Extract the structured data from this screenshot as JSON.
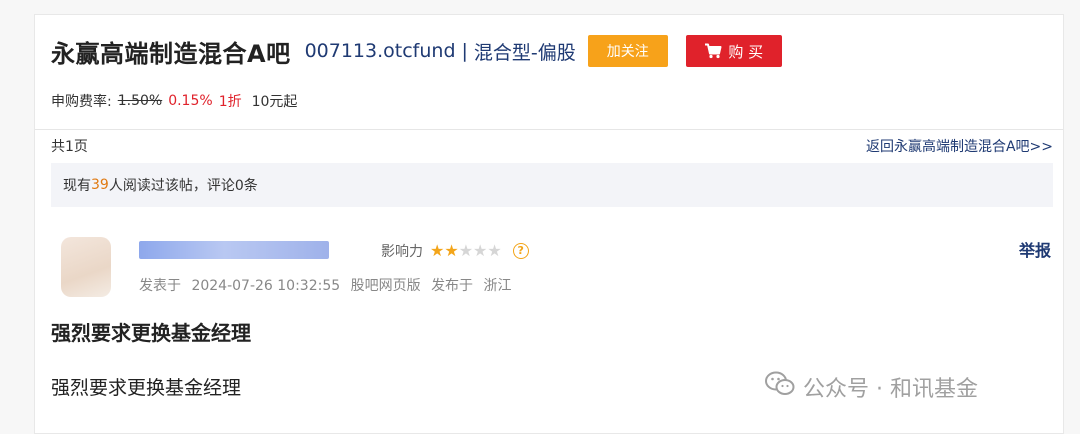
{
  "header": {
    "fund_name": "永赢高端制造混合A吧",
    "fund_code": "007113.otcfund",
    "separator": "|",
    "fund_type": "混合型-偏股",
    "follow_label": "加关注",
    "buy_label": "购 买"
  },
  "fees": {
    "label": "申购费率:",
    "original": "1.50%",
    "discounted": "0.15%",
    "discount": "1折",
    "minimum": "10元起"
  },
  "pagination": {
    "page_count": "共1页",
    "back_link": "返回永赢高端制造混合A吧>>"
  },
  "reads": {
    "prefix": "现有",
    "count": "39",
    "suffix": "人阅读过该帖，评论0条"
  },
  "post": {
    "influence_label": "影响力",
    "stars_filled": 2,
    "stars_total": 5,
    "help_icon_text": "?",
    "report_label": "举报",
    "posted_label": "发表于",
    "posted_time": "2024-07-26 10:32:55",
    "posted_via": "股吧网页版",
    "location_label": "发布于",
    "location": "浙江",
    "title": "强烈要求更换基金经理",
    "body": "强烈要求更换基金经理"
  },
  "watermark": {
    "text": "公众号 · 和讯基金"
  },
  "colors": {
    "follow_button": "#f7a21a",
    "buy_button": "#e0222b",
    "link": "#1f3a73",
    "star_on": "#f3a51a",
    "star_off": "#d6d6d6",
    "highlight": "#e07a13"
  },
  "icons": {
    "cart": "cart-icon",
    "help": "help-circle-icon",
    "watermark": "wechat-icon"
  }
}
